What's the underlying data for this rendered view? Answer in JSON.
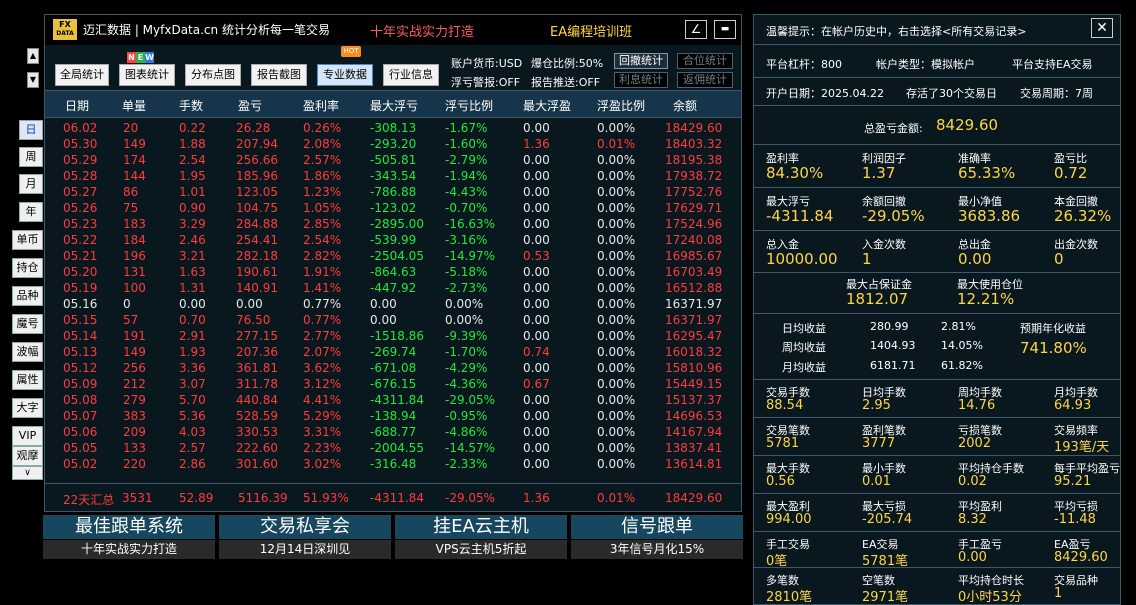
{
  "side": {
    "up": "▲",
    "down": "▼",
    "period_buttons": [
      "日",
      "周",
      "月",
      "年"
    ],
    "tool_buttons": [
      "单币",
      "持仓",
      "品种",
      "魔号",
      "波幅",
      "属性",
      "大字",
      "VIP",
      "观摩"
    ],
    "collapse": "∨"
  },
  "header": {
    "logo_top": "FX",
    "logo_bottom": "DATA",
    "title": "迈汇数据 | MyfxData.cn  统计分析每一笔交易",
    "slogan": "十年实战实力打造",
    "course": "EA编程培训班",
    "edit_icon": "∠",
    "minimize_icon": "▬"
  },
  "toolbar": {
    "buttons": [
      "全局统计",
      "图表统计",
      "分布点图",
      "报告截图",
      "专业数据",
      "行业信息"
    ],
    "new_badge": [
      "N",
      "E",
      "W"
    ],
    "hot_badge": "HOT",
    "currency": "账户货币:USD",
    "blowup": "爆仓比例:50%",
    "float_alert": "浮亏警报:OFF",
    "report_push": "报告推送:OFF",
    "mini_buttons": [
      "回撤统计",
      "合位统计",
      "利息统计",
      "返佣统计"
    ]
  },
  "table": {
    "headers": [
      "日期",
      "单量",
      "手数",
      "盈亏",
      "盈利率",
      "最大浮亏",
      "浮亏比例",
      "最大浮盈",
      "浮盈比例",
      "余额"
    ],
    "rows": [
      [
        "06.02",
        "20",
        "0.22",
        "26.28",
        "0.26%",
        "-308.13",
        "-1.67%",
        "0.00",
        "0.00%",
        "18429.60"
      ],
      [
        "05.30",
        "149",
        "1.88",
        "207.94",
        "2.08%",
        "-293.20",
        "-1.60%",
        "1.36",
        "0.01%",
        "18403.32"
      ],
      [
        "05.29",
        "174",
        "2.54",
        "256.66",
        "2.57%",
        "-505.81",
        "-2.79%",
        "0.00",
        "0.00%",
        "18195.38"
      ],
      [
        "05.28",
        "144",
        "1.95",
        "185.96",
        "1.86%",
        "-343.54",
        "-1.94%",
        "0.00",
        "0.00%",
        "17938.72"
      ],
      [
        "05.27",
        "86",
        "1.01",
        "123.05",
        "1.23%",
        "-786.88",
        "-4.43%",
        "0.00",
        "0.00%",
        "17752.76"
      ],
      [
        "05.26",
        "75",
        "0.90",
        "104.75",
        "1.05%",
        "-123.02",
        "-0.70%",
        "0.00",
        "0.00%",
        "17629.71"
      ],
      [
        "05.23",
        "183",
        "3.29",
        "284.88",
        "2.85%",
        "-2895.00",
        "-16.63%",
        "0.00",
        "0.00%",
        "17524.96"
      ],
      [
        "05.22",
        "184",
        "2.46",
        "254.41",
        "2.54%",
        "-539.99",
        "-3.16%",
        "0.00",
        "0.00%",
        "17240.08"
      ],
      [
        "05.21",
        "196",
        "3.21",
        "282.18",
        "2.82%",
        "-2504.05",
        "-14.97%",
        "0.53",
        "0.00%",
        "16985.67"
      ],
      [
        "05.20",
        "131",
        "1.63",
        "190.61",
        "1.91%",
        "-864.63",
        "-5.18%",
        "0.00",
        "0.00%",
        "16703.49"
      ],
      [
        "05.19",
        "100",
        "1.31",
        "140.91",
        "1.41%",
        "-447.92",
        "-2.73%",
        "0.00",
        "0.00%",
        "16512.88"
      ],
      [
        "05.16",
        "0",
        "0.00",
        "0.00",
        "0.77%",
        "0.00",
        "0.00%",
        "0.00",
        "0.00%",
        "16371.97"
      ],
      [
        "05.15",
        "57",
        "0.70",
        "76.50",
        "0.77%",
        "0.00",
        "0.00%",
        "0.00",
        "0.00%",
        "16371.97"
      ],
      [
        "05.14",
        "191",
        "2.91",
        "277.15",
        "2.77%",
        "-1518.86",
        "-9.39%",
        "0.00",
        "0.00%",
        "16295.47"
      ],
      [
        "05.13",
        "149",
        "1.93",
        "207.36",
        "2.07%",
        "-269.74",
        "-1.70%",
        "0.74",
        "0.00%",
        "16018.32"
      ],
      [
        "05.12",
        "256",
        "3.36",
        "361.81",
        "3.62%",
        "-671.08",
        "-4.29%",
        "0.00",
        "0.00%",
        "15810.96"
      ],
      [
        "05.09",
        "212",
        "3.07",
        "311.78",
        "3.12%",
        "-676.15",
        "-4.36%",
        "0.67",
        "0.00%",
        "15449.15"
      ],
      [
        "05.08",
        "279",
        "5.70",
        "440.84",
        "4.41%",
        "-4311.84",
        "-29.05%",
        "0.00",
        "0.00%",
        "15137.37"
      ],
      [
        "05.07",
        "383",
        "5.36",
        "528.59",
        "5.29%",
        "-138.94",
        "-0.95%",
        "0.00",
        "0.00%",
        "14696.53"
      ],
      [
        "05.06",
        "209",
        "4.03",
        "330.53",
        "3.31%",
        "-688.77",
        "-4.86%",
        "0.00",
        "0.00%",
        "14167.94"
      ],
      [
        "05.05",
        "133",
        "2.57",
        "222.60",
        "2.23%",
        "-2004.55",
        "-14.57%",
        "0.00",
        "0.00%",
        "13837.41"
      ],
      [
        "05.02",
        "220",
        "2.86",
        "301.60",
        "3.02%",
        "-316.48",
        "-2.33%",
        "0.00",
        "0.00%",
        "13614.81"
      ]
    ],
    "summary": [
      "22天汇总",
      "3531",
      "52.89",
      "5116.39",
      "51.93%",
      "-4311.84",
      "-29.05%",
      "1.36",
      "0.01%",
      "18429.60"
    ]
  },
  "banners": [
    {
      "title": "最佳跟单系统",
      "sub": "十年实战实力打造"
    },
    {
      "title": "交易私享会",
      "sub": "12月14日深圳见"
    },
    {
      "title": "挂EA云主机",
      "sub": "VPS云主机5折起"
    },
    {
      "title": "信号跟单",
      "sub": "3年信号月化15%"
    }
  ],
  "right": {
    "tip": "温馨提示：在帐户历史中，右击选择<所有交易记录>",
    "close": "✕",
    "leverage": "平台杠杆：800",
    "account_type": "帐户类型：模拟帐户",
    "ea_support": "平台支持EA交易",
    "open_date": "开户日期：2025.04.22",
    "days": "存活了30个交易日",
    "cycle": "交易周期：7周",
    "total_pl_label": "总盈亏金额:",
    "total_pl": "8429.60",
    "grid1": [
      {
        "label": "盈利率",
        "value": "84.30%"
      },
      {
        "label": "利润因子",
        "value": "1.37"
      },
      {
        "label": "准确率",
        "value": "65.33%"
      },
      {
        "label": "盈亏比",
        "value": "0.72"
      }
    ],
    "grid2": [
      {
        "label": "最大浮亏",
        "value": "-4311.84"
      },
      {
        "label": "余额回撤",
        "value": "-29.05%"
      },
      {
        "label": "最小净值",
        "value": "3683.86"
      },
      {
        "label": "本金回撤",
        "value": "26.32%"
      }
    ],
    "grid3": [
      {
        "label": "总入金",
        "value": "10000.00"
      },
      {
        "label": "入金次数",
        "value": "1"
      },
      {
        "label": "总出金",
        "value": "0.00"
      },
      {
        "label": "出金次数",
        "value": "0"
      }
    ],
    "margin": [
      {
        "label": "最大占保证金",
        "value": "1812.07"
      },
      {
        "label": "最大使用仓位",
        "value": "12.21%"
      }
    ],
    "returns": [
      {
        "label": "日均收益",
        "value": "280.99",
        "pct": "2.81%"
      },
      {
        "label": "周均收益",
        "value": "1404.93",
        "pct": "14.05%"
      },
      {
        "label": "月均收益",
        "value": "6181.71",
        "pct": "61.82%"
      }
    ],
    "annual_label": "预期年化收益",
    "annual_value": "741.80%",
    "grid4": [
      {
        "label": "交易手数",
        "value": "88.54"
      },
      {
        "label": "日均手数",
        "value": "2.95"
      },
      {
        "label": "周均手数",
        "value": "14.76"
      },
      {
        "label": "月均手数",
        "value": "64.93"
      }
    ],
    "grid5": [
      {
        "label": "交易笔数",
        "value": "5781"
      },
      {
        "label": "盈利笔数",
        "value": "3777"
      },
      {
        "label": "亏损笔数",
        "value": "2002"
      },
      {
        "label": "交易频率",
        "value": "193笔/天"
      }
    ],
    "grid6": [
      {
        "label": "最大手数",
        "value": "0.56"
      },
      {
        "label": "最小手数",
        "value": "0.01"
      },
      {
        "label": "平均持仓手数",
        "value": "0.02"
      },
      {
        "label": "每手平均盈亏",
        "value": "95.21"
      }
    ],
    "grid7": [
      {
        "label": "最大盈利",
        "value": "994.00"
      },
      {
        "label": "最大亏损",
        "value": "-205.74"
      },
      {
        "label": "平均盈利",
        "value": "8.32"
      },
      {
        "label": "平均亏损",
        "value": "-11.48"
      }
    ],
    "grid8": [
      {
        "label": "手工交易",
        "value": "0笔"
      },
      {
        "label": "EA交易",
        "value": "5781笔"
      },
      {
        "label": "手工盈亏",
        "value": "0.00"
      },
      {
        "label": "EA盈亏",
        "value": "8429.60"
      }
    ],
    "grid9": [
      {
        "label": "多笔数",
        "value": "2810笔"
      },
      {
        "label": "空笔数",
        "value": "2971笔"
      },
      {
        "label": "平均持仓时长",
        "value": "0小时53分"
      },
      {
        "label": "交易品种",
        "value": "1"
      }
    ]
  }
}
